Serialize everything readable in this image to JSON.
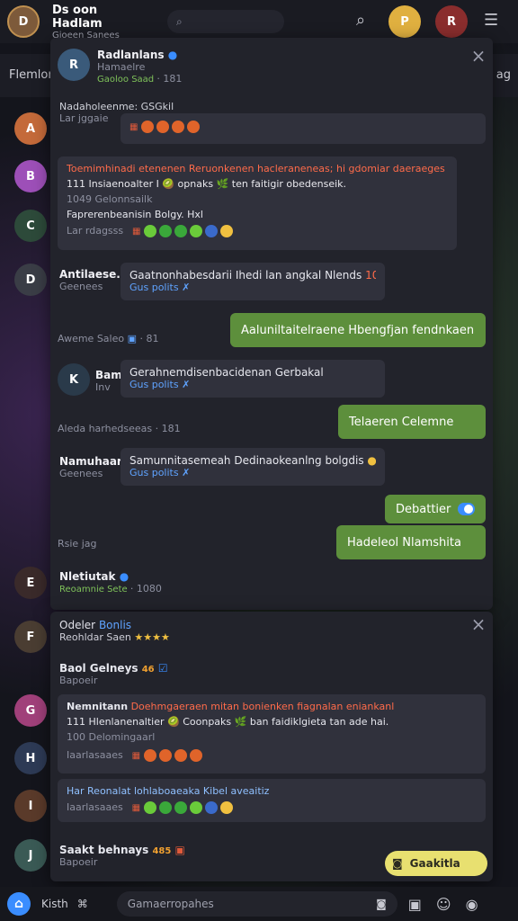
{
  "topbar": {
    "app_name": "Ds oon Hadlam",
    "subtitle": "Gioeen Sanees"
  },
  "subbar": {
    "left": "Flemlon",
    "right": "ag"
  },
  "panel1": {
    "header": {
      "name": "Radlanlans",
      "sub": "Hamaelre",
      "meta": "Gaoloo Saad",
      "count": "· 181"
    },
    "msg1": {
      "sender": "Nadaholeenme: GSGkil",
      "sub": "Lar jggaie"
    },
    "msg2": {
      "line1": "Toemimhinadi etenenen Reruonkenen hacleraneneas; hi gdomiar daeraeges lan",
      "line2": "111 Insiaenoalter I 🥝 opnaks 🌿 ten faitigir obedenseik.",
      "line3": "1049 Gelonnsailk",
      "line4": "Faprerenbeanisin Bolgy. Hxl",
      "stamp": "Lar rdagsss"
    },
    "msg3": {
      "sender": "Antilaese.",
      "sub": "Geenees",
      "text": "Gaatnonhabesdarii Ihedi lan angkal Nlends",
      "num": "10",
      "status": "Gus polits ✗"
    },
    "out1": {
      "text": "Aaluniltaitelraene Hbengfjan fendnkaen"
    },
    "stamp1": {
      "left": "Aweme Saleo",
      "count": "· 81"
    },
    "msg4": {
      "sender": "Bam",
      "sub": "Inv",
      "text": "Gerahnemdisenbacidenan Gerbakal",
      "status": "Gus polits ✗"
    },
    "out2": {
      "text": "Telaeren Celemne"
    },
    "stamp2": {
      "left": "Aleda harhedseeas",
      "count": "· 181"
    },
    "msg5": {
      "sender": "Namuhaarl",
      "sub": "Geenees",
      "text": "Samunnitasemeah Dedinaokeanlng bolgdis",
      "status": "Gus polits ✗"
    },
    "out3": {
      "text": "Debattier"
    },
    "out4": {
      "text": "Hadeleol Nlamshita"
    },
    "stamp3": {
      "left": "Rsie jag"
    }
  },
  "between": {
    "name": "Nletiutak",
    "sub": "Reoamnie Sete",
    "meta": "· 1080"
  },
  "panel2": {
    "header": {
      "name": "Odeler",
      "tag": "Bonlis",
      "sub": "Reohldar Saen"
    },
    "item1": {
      "name": "Baol Gelneys",
      "count": "46",
      "sub": "Bapoeir"
    },
    "msg1": {
      "sender": "Nemnitann",
      "line1": "Doehmgaeraen mitan bonienken fiagnalan eniankanl",
      "line2": "111 Hlenlanenaltier 🥝 Coonpaks 🌿 ban faidiklgieta tan ade hai.",
      "line3": "100 Delomingaarl",
      "stamp": "Iaarlasaaes"
    },
    "msg2": {
      "line1": "Har Reonalat lohlaboaeaka Kibel aveaitiz",
      "stamp": "Iaarlasaaes"
    },
    "item2": {
      "name": "Saakt behnays",
      "count": "485",
      "sub": "Bapoeir"
    },
    "cta": "Gaakitla"
  },
  "bottom": {
    "left": "Kisth",
    "input_placeholder": "Gamaerropahes"
  }
}
